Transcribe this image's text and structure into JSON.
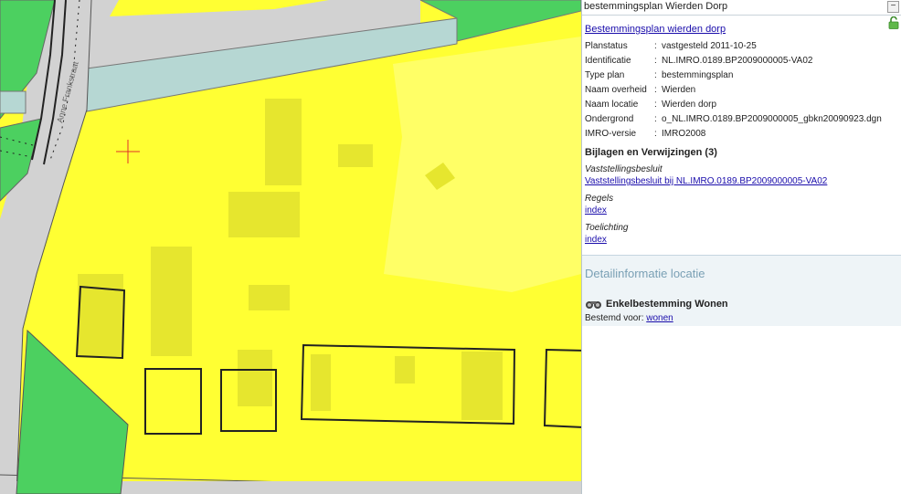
{
  "panel": {
    "title": "bestemmingsplan Wierden Dorp",
    "collapse_label": "−",
    "plan_name": "Bestemmingsplan wierden dorp",
    "fields": [
      {
        "key": "Planstatus",
        "value": "vastgesteld 2011-10-25"
      },
      {
        "key": "Identificatie",
        "value": "NL.IMRO.0189.BP2009000005-VA02"
      },
      {
        "key": "Type plan",
        "value": "bestemmingsplan"
      },
      {
        "key": "Naam overheid",
        "value": "Wierden"
      },
      {
        "key": "Naam locatie",
        "value": "Wierden dorp"
      },
      {
        "key": "Ondergrond",
        "value": "o_NL.IMRO.0189.BP2009000005_gbkn20090923.dgn"
      },
      {
        "key": "IMRO-versie",
        "value": "IMRO2008"
      }
    ],
    "separator": ":",
    "bijlagen_title": "Bijlagen en Verwijzingen (3)",
    "documents": [
      {
        "category": "Vaststellingsbesluit",
        "link": "Vaststellingsbesluit bij NL.IMRO.0189.BP2009000005-VA02"
      },
      {
        "category": "Regels",
        "link": "index"
      },
      {
        "category": "Toelichting",
        "link": "index"
      }
    ],
    "detail_title": "Detailinformatie locatie",
    "enkel_title": "Enkelbestemming Wonen",
    "bestemd_label": "Bestemd voor:",
    "bestemd_link": "wonen"
  },
  "map": {
    "street_label": "Anne Frankstraat",
    "colors": {
      "wonen": "#ffff33",
      "groen": "#4cd060",
      "water": "#b6d7d3",
      "road": "#cfcfcf",
      "building_outline": "#222222",
      "cursor": "#e0302a"
    }
  }
}
